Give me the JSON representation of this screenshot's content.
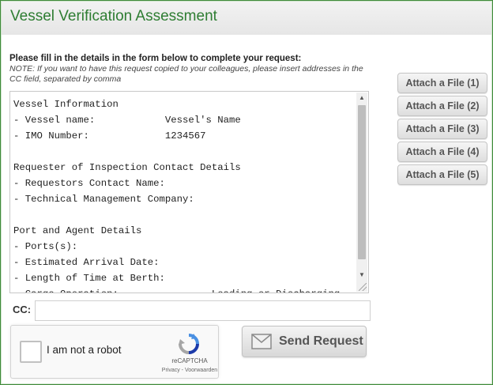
{
  "header": {
    "title": "Vessel Verification Assessment"
  },
  "intro": {
    "lead": "Please fill in the details in the form below to complete your request:",
    "note": "NOTE: If you want to have this request copied to your colleagues, please insert addresses in the CC field, separated by comma"
  },
  "request_text": "Vessel Information\n- Vessel name:            Vessel's Name\n- IMO Number:             1234567\n\nRequester of Inspection Contact Details\n- Requestors Contact Name:\n- Technical Management Company:\n\nPort and Agent Details\n- Ports(s):\n- Estimated Arrival Date:\n- Length of Time at Berth:\n- Cargo Operation:                Loading or Discharging",
  "cc": {
    "label": "CC:",
    "value": ""
  },
  "attachments": [
    {
      "label": "Attach a File (1)"
    },
    {
      "label": "Attach a File (2)"
    },
    {
      "label": "Attach a File (3)"
    },
    {
      "label": "Attach a File (4)"
    },
    {
      "label": "Attach a File (5)"
    }
  ],
  "captcha": {
    "checkbox_label": "I am not a robot",
    "brand": "reCAPTCHA",
    "terms": "Privacy - Voorwaarden"
  },
  "send_button": {
    "label": "Send Request"
  },
  "colors": {
    "title_green": "#2e7d32",
    "border_green": "#3f8a3a"
  }
}
